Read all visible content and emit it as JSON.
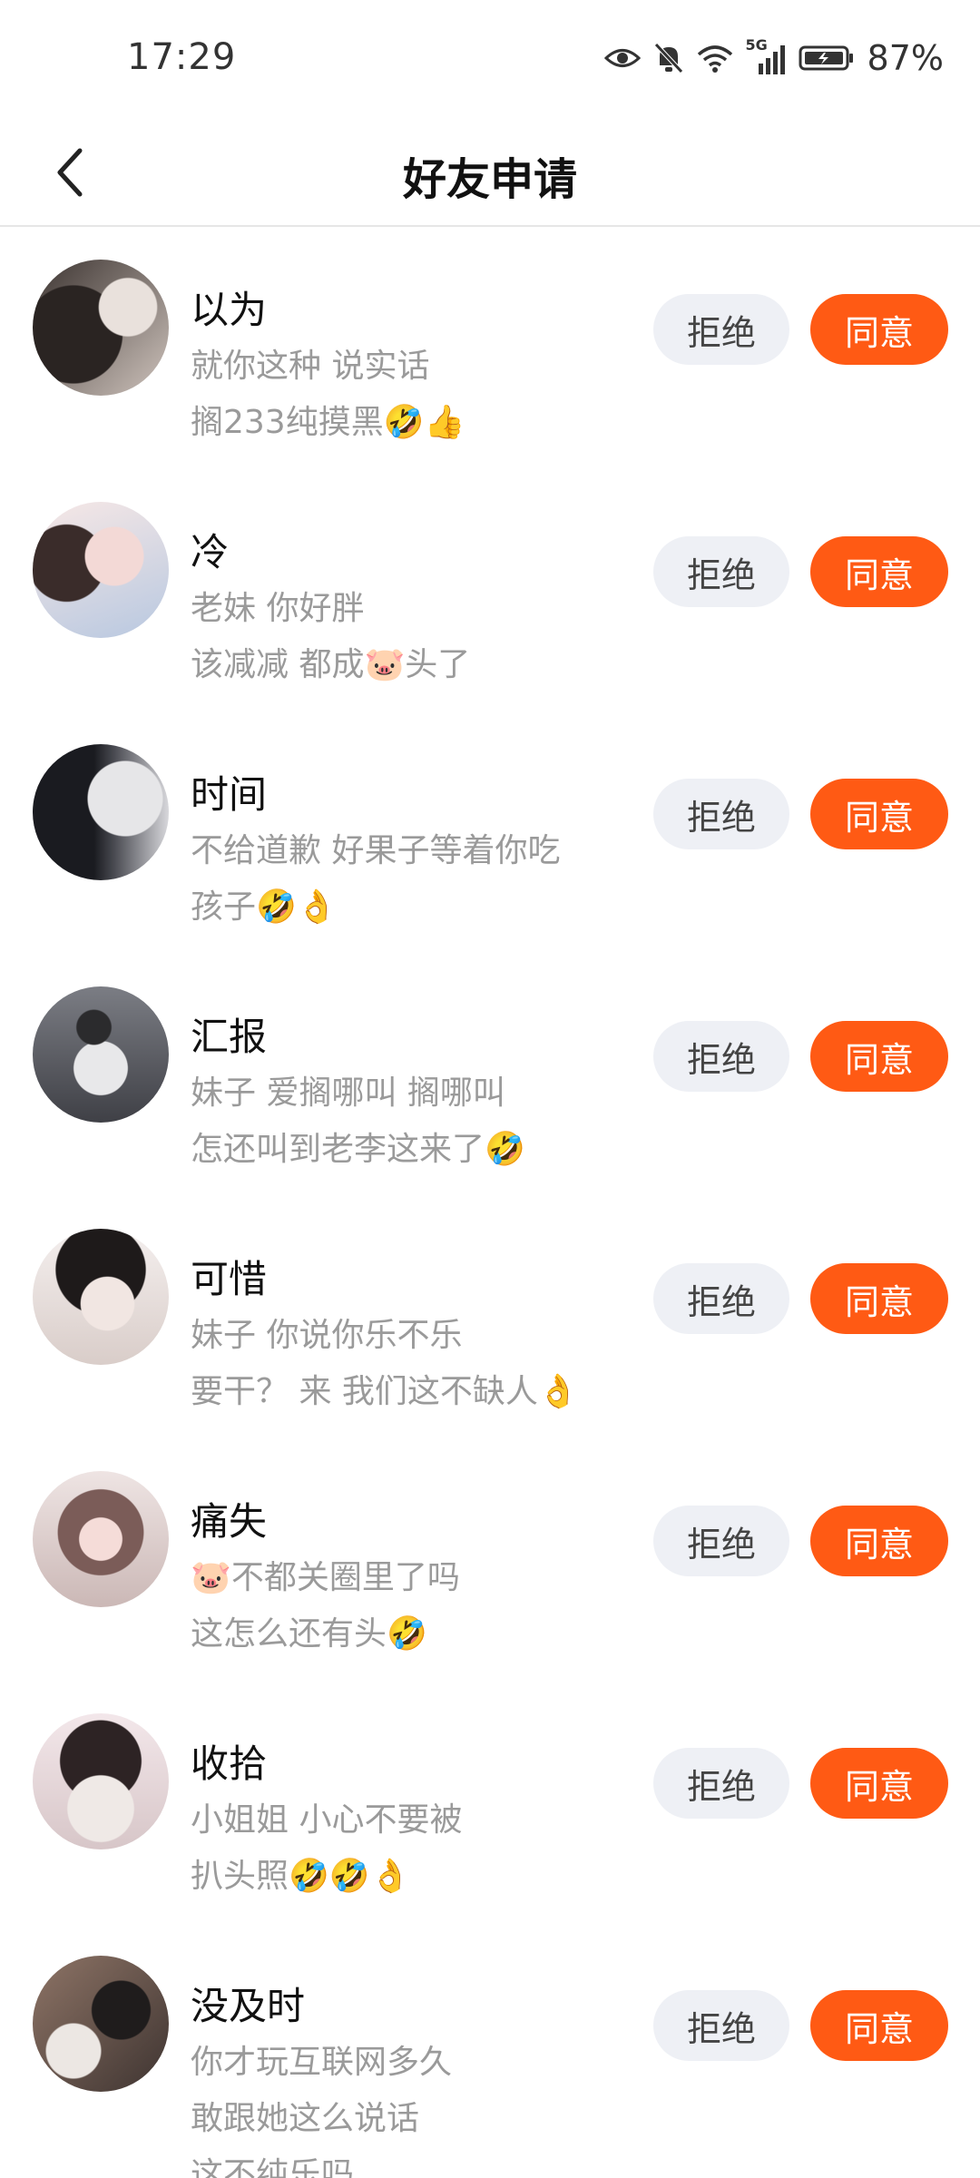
{
  "status": {
    "time": "17:29",
    "network": "5G",
    "battery": "87%"
  },
  "header": {
    "title": "好友申请"
  },
  "colors": {
    "accent": "#ff5a14",
    "reject_bg": "#eef0f5"
  },
  "requests": [
    {
      "name": "以为",
      "lines": [
        "就你这种 说实话",
        "搁233纯摸黑🤣👍"
      ],
      "reject": "拒绝",
      "accept": "同意"
    },
    {
      "name": "冷",
      "lines": [
        "老妹 你好胖",
        "该减减 都成🐷头了"
      ],
      "reject": "拒绝",
      "accept": "同意"
    },
    {
      "name": "时间",
      "lines": [
        "不给道歉 好果子等着你吃",
        "孩子🤣👌"
      ],
      "reject": "拒绝",
      "accept": "同意"
    },
    {
      "name": "汇报",
      "lines": [
        "妹子 爱搁哪叫 搁哪叫",
        "怎还叫到老李这来了🤣"
      ],
      "reject": "拒绝",
      "accept": "同意"
    },
    {
      "name": "可惜",
      "lines": [
        "妹子 你说你乐不乐",
        "要干？ 来 我们这不缺人👌"
      ],
      "reject": "拒绝",
      "accept": "同意"
    },
    {
      "name": "痛失",
      "lines": [
        "🐷不都关圈里了吗",
        "这怎么还有头🤣"
      ],
      "reject": "拒绝",
      "accept": "同意"
    },
    {
      "name": "收拾",
      "lines": [
        "小姐姐 小心不要被",
        "扒头照🤣🤣👌"
      ],
      "reject": "拒绝",
      "accept": "同意"
    },
    {
      "name": "没及时",
      "lines": [
        "你才玩互联网多久",
        "敢跟她这么说话",
        "这不纯乐吗"
      ],
      "reject": "拒绝",
      "accept": "同意"
    }
  ]
}
